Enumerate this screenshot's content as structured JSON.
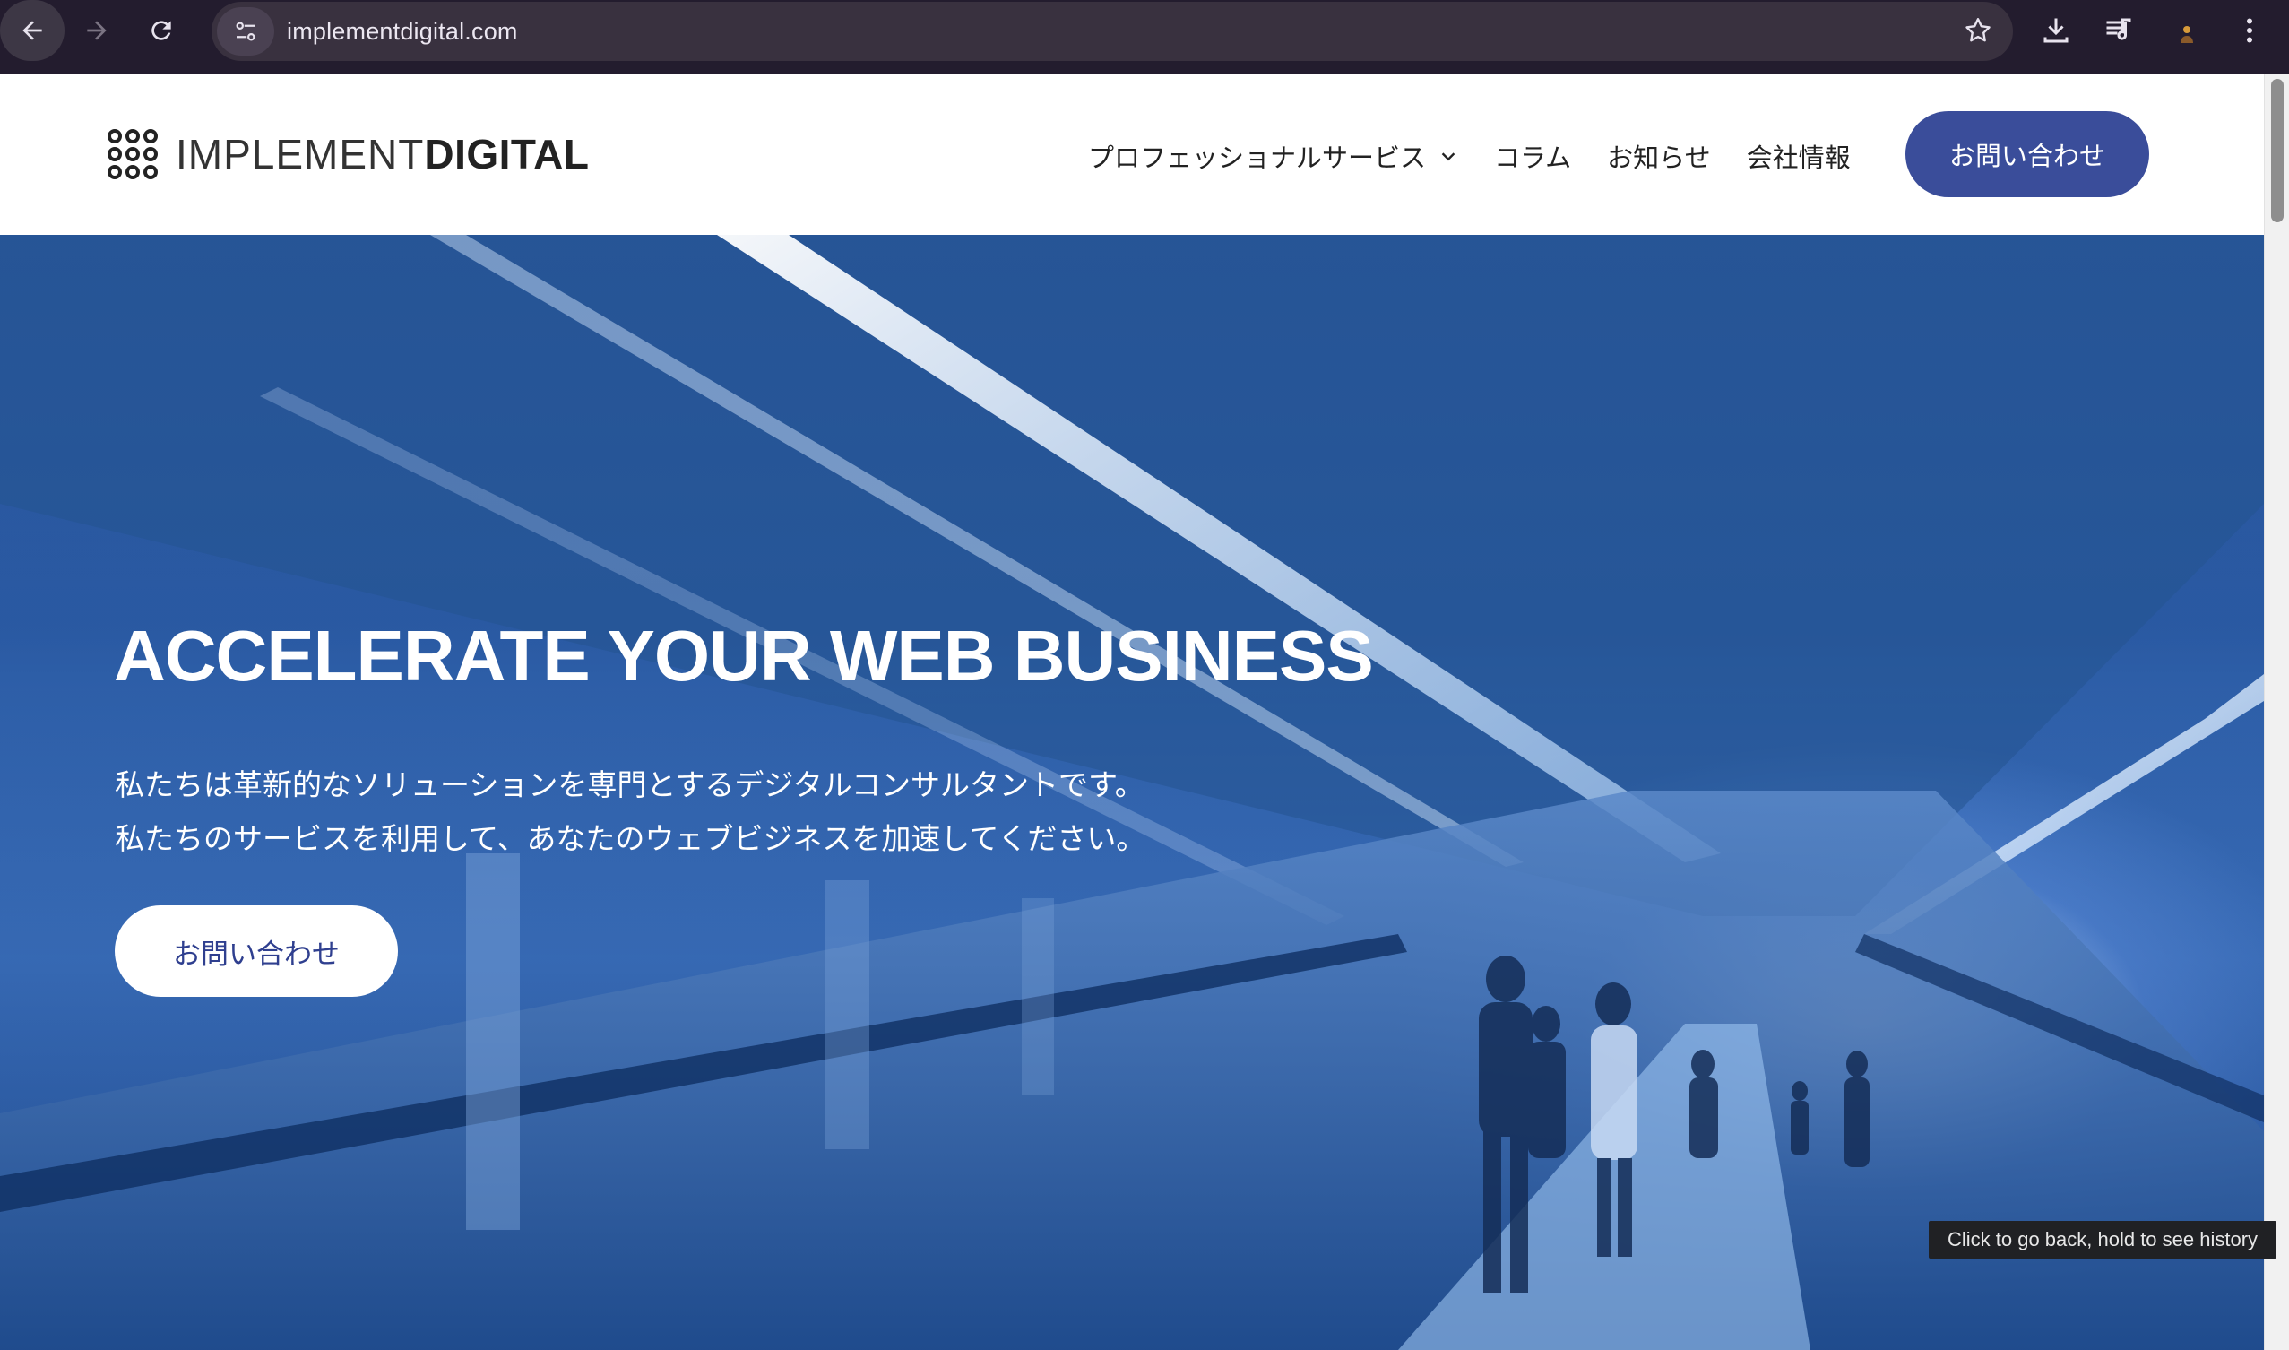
{
  "browser": {
    "url": "implementdigital.com",
    "tooltip": "Click to go back, hold to see history"
  },
  "header": {
    "logo_light": "IMPLEMENT",
    "logo_bold": "DIGITAL",
    "nav": [
      {
        "label": "プロフェッショナルサービス",
        "has_dropdown": true
      },
      {
        "label": "コラム"
      },
      {
        "label": "お知らせ"
      },
      {
        "label": "会社情報"
      }
    ],
    "cta_label": "お問い合わせ"
  },
  "hero": {
    "title": "ACCELERATE YOUR WEB BUSINESS",
    "line1": "私たちは革新的なソリューションを専門とするデジタルコンサルタントです。",
    "line2": "私たちのサービスを利用して、あなたのウェブビジネスを加速してください。",
    "cta_label": "お問い合わせ"
  },
  "colors": {
    "brand_blue": "#3a4d9a",
    "chrome_bg": "#231c2e"
  }
}
